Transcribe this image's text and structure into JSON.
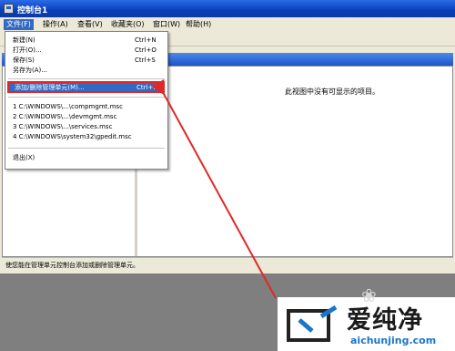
{
  "window": {
    "title": "控制台1"
  },
  "menubar": {
    "items": [
      {
        "label": "文件(F)",
        "active": true
      },
      {
        "label": "操作(A)"
      },
      {
        "label": "查看(V)"
      },
      {
        "label": "收藏夹(O)"
      },
      {
        "label": "窗口(W)"
      },
      {
        "label": "帮助(H)"
      }
    ]
  },
  "file_menu": {
    "items": [
      {
        "label": "新建(N)",
        "shortcut": "Ctrl+N"
      },
      {
        "label": "打开(O)...",
        "shortcut": "Ctrl+O"
      },
      {
        "label": "保存(S)",
        "shortcut": "Ctrl+S"
      },
      {
        "label": "另存为(A)..."
      },
      {
        "label": "添加/删除管理单元(M)...",
        "shortcut": "Ctrl+M",
        "highlighted": true
      },
      {
        "label": "1 C:\\WINDOWS\\...\\compmgmt.msc"
      },
      {
        "label": "2 C:\\WINDOWS\\...\\devmgmt.msc"
      },
      {
        "label": "3 C:\\WINDOWS\\...\\services.msc"
      },
      {
        "label": "4 C:\\WINDOWS\\system32\\gpedit.msc"
      },
      {
        "label": "退出(X)"
      }
    ]
  },
  "main": {
    "empty_message": "此视图中没有可显示的项目。"
  },
  "statusbar": {
    "text": "使您能在管理单元控制台添加或删除管理单元。"
  },
  "watermark": {
    "name": "爱纯净",
    "url": "aichunjing.com"
  },
  "colors": {
    "annotation_red": "#e02828",
    "highlight": "#316ac5",
    "titlebar": "#0a3fb8"
  }
}
